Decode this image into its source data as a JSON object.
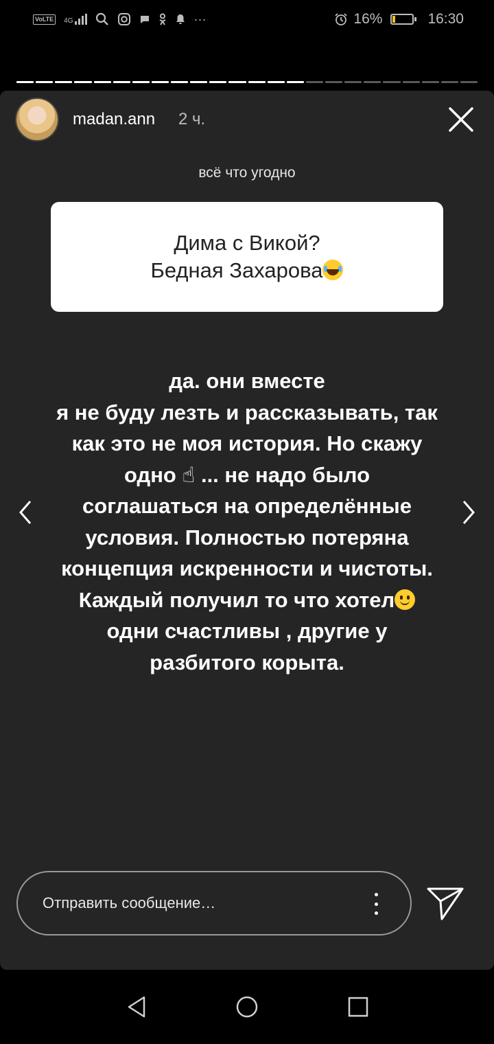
{
  "status_bar": {
    "volte": "VoLTE",
    "network": "4G",
    "battery_percent": "16%",
    "battery_level": 0.16,
    "time": "16:30",
    "icons": [
      "volte-icon",
      "signal-icon",
      "search-icon",
      "instagram-icon",
      "message-icon",
      "ok-icon",
      "notification-icon",
      "more-notifications-icon",
      "alarm-icon",
      "battery-icon"
    ]
  },
  "story": {
    "segments_total": 24,
    "segments_viewed": 15,
    "username": "madan.ann",
    "time_ago": "2 ч.",
    "prompt_label": "всё что угодно",
    "question_lines": [
      "Дима с Викой?",
      "Бедная Захарова"
    ],
    "answer_lines": [
      "да. они вместе",
      "я не буду лезть и рассказывать, так",
      "как это не моя история. Но скажу",
      "одно ☝ ... не надо было",
      "соглашаться на определённые",
      "условия. Полностью потеряна",
      "концепция искренности и чистоты.",
      "Каждый получил то что хотел",
      "одни счастливы , другие у",
      "разбитого корыта."
    ],
    "message_placeholder": "Отправить сообщение…"
  },
  "colors": {
    "story_bg": "#252525",
    "screen_bg": "#000000",
    "question_bg": "#ffffff",
    "battery_fill": "#f0c020"
  }
}
